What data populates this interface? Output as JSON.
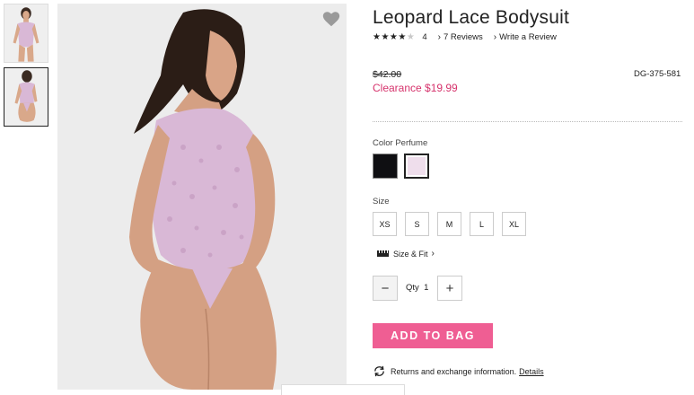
{
  "product": {
    "title": "Leopard Lace Bodysuit",
    "rating_stars": "★★★★★",
    "rating_value": 4,
    "rating_count": "4",
    "reviews_link": "7 Reviews",
    "write_review_link": "Write a Review",
    "old_price": "$42.00",
    "sale_price": "Clearance $19.99",
    "sku": "DG-375-581"
  },
  "color": {
    "label": "Color Perfume",
    "swatches": [
      {
        "name": "black",
        "hex": "#0f0f12"
      },
      {
        "name": "perfume",
        "hex": "#efdeec",
        "selected": true
      }
    ]
  },
  "size": {
    "label": "Size",
    "options": [
      "XS",
      "S",
      "M",
      "L",
      "XL"
    ]
  },
  "size_fit_label": "Size & Fit",
  "quantity": {
    "label": "Qty",
    "value": "1",
    "minus": "−",
    "plus": "+"
  },
  "add_to_bag": "ADD TO BAG",
  "returns": {
    "text": "Returns and exchange information.",
    "link": "Details"
  },
  "colors": {
    "accent": "#ef5e93",
    "sale_text": "#d6336c",
    "garment": "#d9b8d6"
  }
}
